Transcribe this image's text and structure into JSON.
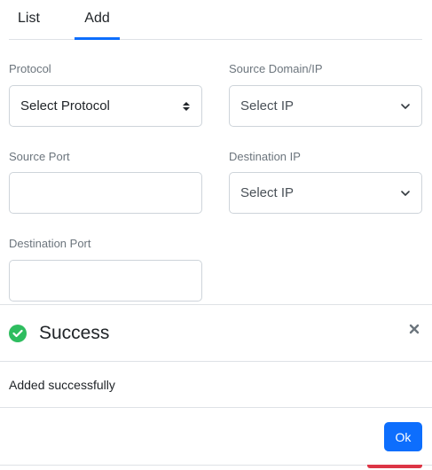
{
  "tabs": [
    {
      "label": "List",
      "active": false
    },
    {
      "label": "Add",
      "active": true
    }
  ],
  "form": {
    "protocol": {
      "label": "Protocol",
      "value": "Select Protocol"
    },
    "source_domain": {
      "label": "Source Domain/IP",
      "value": "Select IP"
    },
    "source_port": {
      "label": "Source Port",
      "value": ""
    },
    "destination_ip": {
      "label": "Destination IP",
      "value": "Select IP"
    },
    "destination_port": {
      "label": "Destination Port",
      "value": ""
    }
  },
  "modal": {
    "title": "Success",
    "message": "Added successfully",
    "ok_label": "Ok",
    "icon": "check-circle-icon",
    "close_icon": "close-icon"
  },
  "colors": {
    "accent": "#0d6efd",
    "success": "#2ebd5f",
    "danger": "#dc3545"
  }
}
